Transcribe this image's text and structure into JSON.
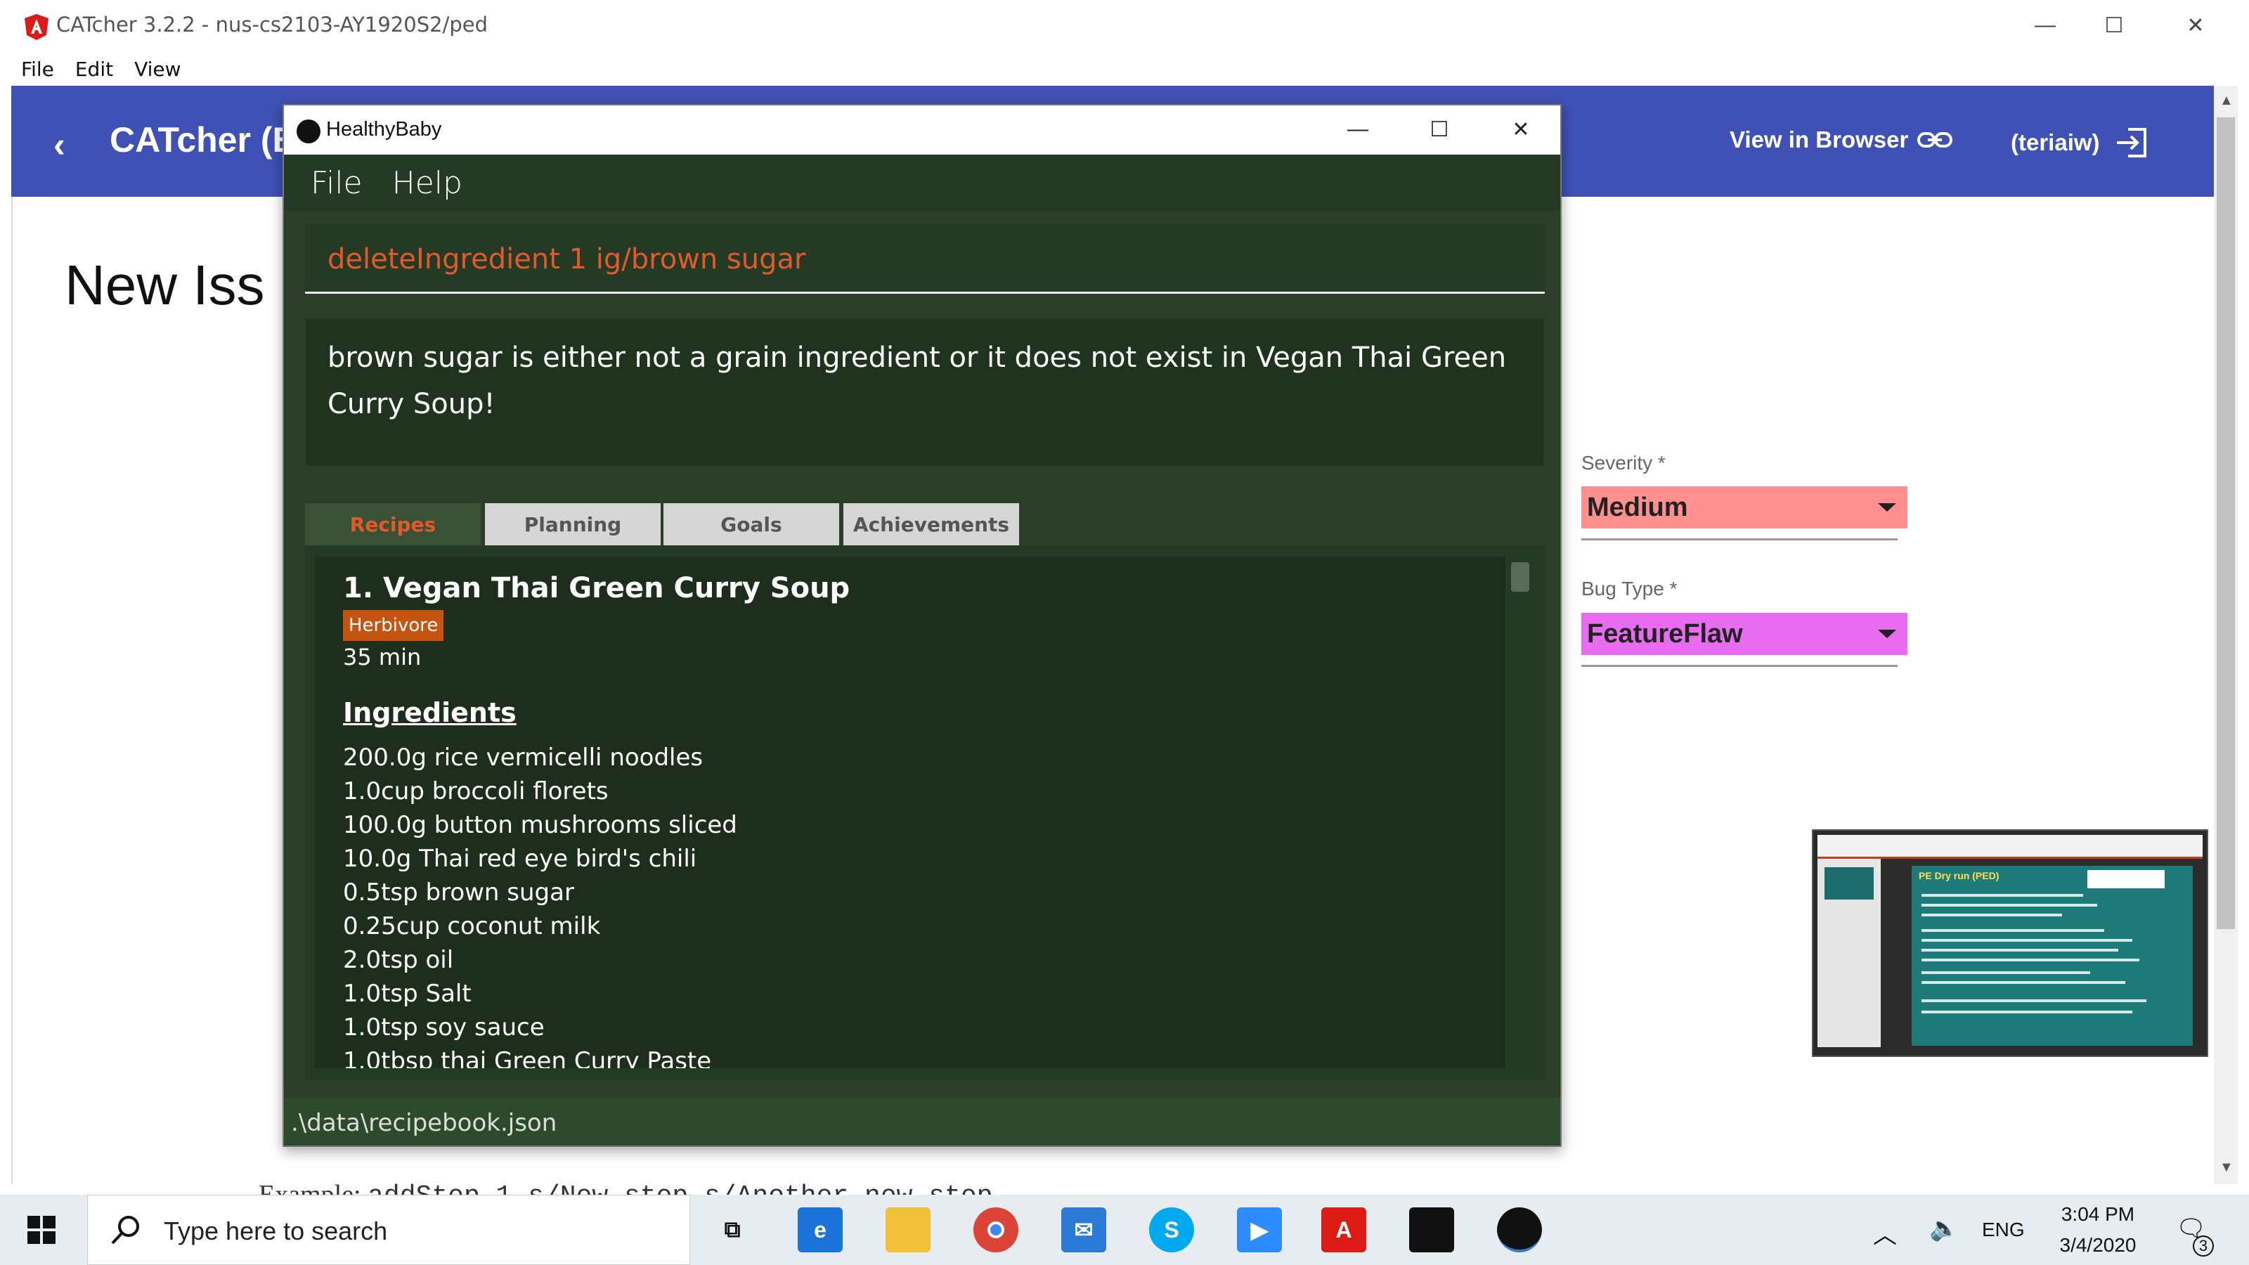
{
  "outer_window": {
    "title": "CATcher 3.2.2 - nus-cs2103-AY1920S2/ped",
    "controls": {
      "minimize": "—",
      "maximize": "☐",
      "close": "✕"
    },
    "menu": [
      "File",
      "Edit",
      "View"
    ]
  },
  "catcher": {
    "back_icon": "‹",
    "brand": "CATcher (B",
    "view_in_browser": "View in Browser",
    "user": "(teriaiw)",
    "page_title": "New Iss",
    "severity": {
      "label": "Severity *",
      "value": "Medium",
      "color": "#ff8f8f"
    },
    "bug_type": {
      "label": "Bug Type *",
      "value": "FeatureFlaw",
      "color": "#e86cf0"
    },
    "background_text_prefix": "Example: ",
    "background_text_code": "addStep 1 s/New step s/Another new step"
  },
  "healthybaby": {
    "title": "HealthyBaby",
    "controls": {
      "minimize": "—",
      "maximize": "☐",
      "close": "✕"
    },
    "menu": {
      "file": "File",
      "help": "Help"
    },
    "command": "deleteIngredient 1 ig/brown sugar",
    "result": "brown sugar is either not a grain ingredient or it does not exist in Vegan Thai Green Curry Soup!",
    "tabs": {
      "recipes": "Recipes",
      "planning": "Planning",
      "goals": "Goals",
      "achievements": "Achievements"
    },
    "recipe": {
      "name": "1.  Vegan Thai Green Curry Soup",
      "tag": "Herbivore",
      "time": "35 min",
      "ingredients_heading": "Ingredients",
      "ingredients": [
        "200.0g rice vermicelli noodles",
        "1.0cup broccoli florets",
        "100.0g button mushrooms sliced",
        "10.0g Thai red eye bird's chili",
        "0.5tsp brown sugar",
        "0.25cup coconut milk",
        "2.0tsp oil",
        "1.0tsp Salt",
        "1.0tsp soy sauce",
        "1.0tbsp thai Green Curry Paste"
      ]
    },
    "status_path": ".\\data\\recipebook.json"
  },
  "presentation": {
    "slide_heading": "PE Dry run (PED)"
  },
  "taskbar": {
    "search_placeholder": "Type here to search",
    "time": "3:04 PM",
    "date": "3/4/2020",
    "language": "ENG",
    "notifications": "3"
  }
}
